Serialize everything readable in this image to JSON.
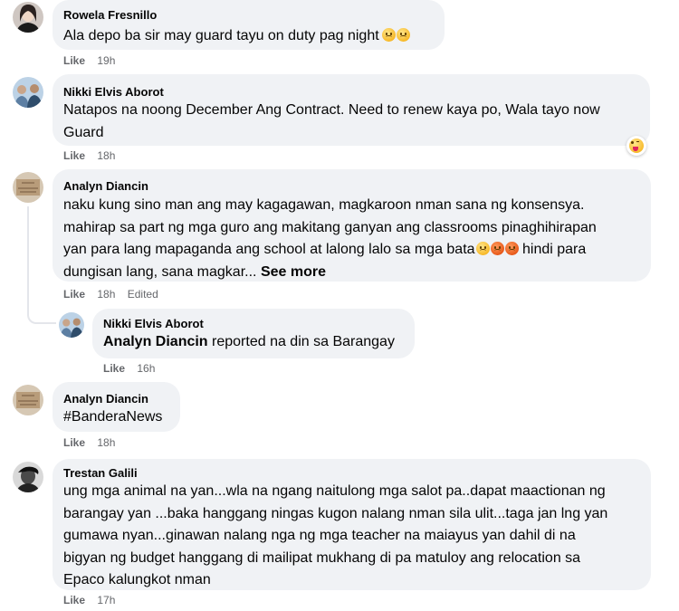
{
  "comments": [
    {
      "author": "Rowela Fresnillo",
      "lines": [
        "Ala depo ba sir may guard tayu on duty pag night"
      ],
      "like": "Like",
      "time": "19h"
    },
    {
      "author": "Nikki Elvis Aborot",
      "lines": [
        "Natapos na noong December Ang Contract. Need to renew kaya po, Wala tayo now",
        "Guard"
      ],
      "like": "Like",
      "time": "18h"
    },
    {
      "author": "Analyn Diancin",
      "lines": [
        "naku kung sino man ang may kagagawan, magkaroon nman sana ng konsensya.",
        "mahirap sa part ng mga guro ang makitang ganyan ang classrooms pinaghihirapan",
        "yan para lang mapaganda ang school at lalong lalo sa mga bata",
        " hindi para",
        "dungisan lang, sana magkar..."
      ],
      "see_more": "See more",
      "like": "Like",
      "time": "18h",
      "edited": "Edited"
    },
    {
      "author": "Nikki Elvis Aborot",
      "mention": "Analyn Diancin",
      "text": " reported na din sa Barangay",
      "like": "Like",
      "time": "16h"
    },
    {
      "author": "Analyn Diancin",
      "lines": [
        "#BanderaNews"
      ],
      "like": "Like",
      "time": "18h"
    },
    {
      "author": "Trestan Galili",
      "lines": [
        "ung mga animal na yan...wla na ngang naitulong mga salot pa..dapat maactionan ng",
        "barangay yan ...baka hanggang ningas kugon nalang nman sila ulit...taga jan lng yan",
        "gumawa nyan...ginawan nalang nga ng mga teacher na maiayus yan dahil di na",
        "bigyan ng budget hanggang di mailipat mukhang di pa matuloy ang relocation sa",
        "Epaco kalungkot nman"
      ],
      "like": "Like",
      "time": "17h"
    }
  ],
  "icons": {
    "sad_emoji": "sad-face-emoji",
    "angry_emoji": "angry-face-emoji",
    "reaction": "tongue-out-wink-reaction"
  },
  "colors": {
    "bubble": "#f0f2f5",
    "meta": "#65676b",
    "text": "#050505"
  }
}
